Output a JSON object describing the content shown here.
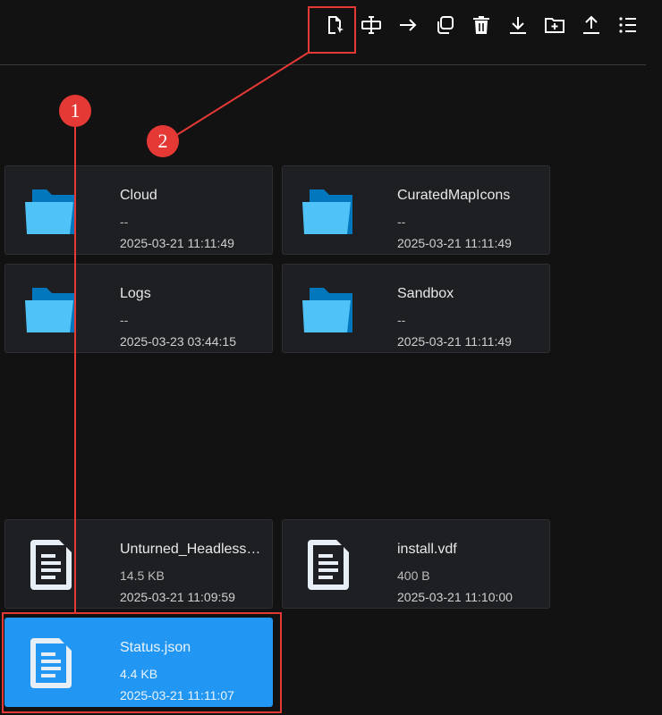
{
  "toolbar": {
    "buttons": [
      {
        "id": "open-file",
        "icon": "file-cursor-icon"
      },
      {
        "id": "rename",
        "icon": "rename-icon"
      },
      {
        "id": "move",
        "icon": "arrow-right-icon"
      },
      {
        "id": "copy",
        "icon": "copy-icon"
      },
      {
        "id": "delete",
        "icon": "trash-icon"
      },
      {
        "id": "download",
        "icon": "download-icon"
      },
      {
        "id": "new-folder",
        "icon": "folder-plus-icon"
      },
      {
        "id": "upload",
        "icon": "upload-icon"
      },
      {
        "id": "view-list",
        "icon": "list-icon"
      }
    ]
  },
  "annotations": {
    "badge1": "1",
    "badge2": "2",
    "color": "#e53935"
  },
  "folders": [
    {
      "name": "Cloud",
      "size": "--",
      "date": "2025-03-21 11:11:49"
    },
    {
      "name": "CuratedMapIcons",
      "size": "--",
      "date": "2025-03-21 11:11:49"
    },
    {
      "name": "Logs",
      "size": "--",
      "date": "2025-03-23 03:44:15"
    },
    {
      "name": "Sandbox",
      "size": "--",
      "date": "2025-03-21 11:11:49"
    }
  ],
  "files": [
    {
      "name": "Unturned_Headless.log",
      "size": "14.5 KB",
      "date": "2025-03-21 11:09:59"
    },
    {
      "name": "install.vdf",
      "size": "400 B",
      "date": "2025-03-21 11:10:00"
    },
    {
      "name": "Status.json",
      "size": "4.4 KB",
      "date": "2025-03-21 11:11:07",
      "selected": true
    }
  ],
  "colors": {
    "folder_front": "#4fc3f7",
    "folder_back": "#0277bd",
    "selected": "#2196f3",
    "file_icon": "#e8eef5"
  }
}
